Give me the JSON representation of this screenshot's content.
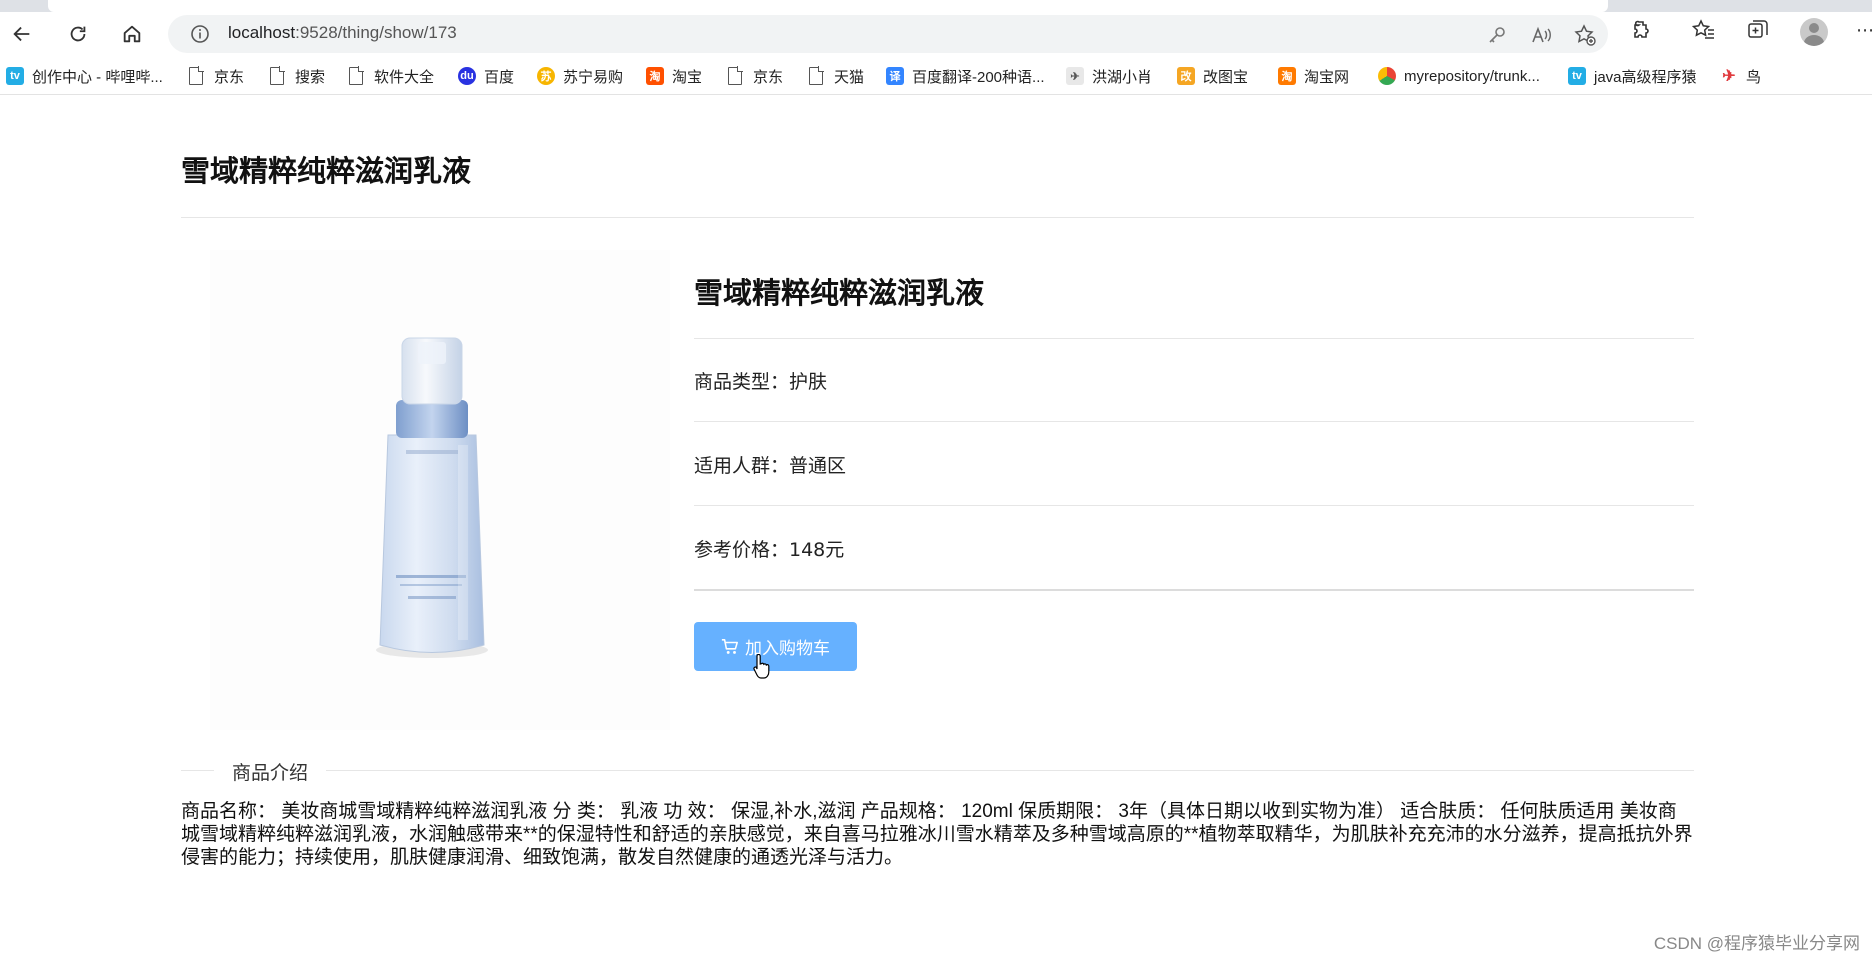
{
  "browser": {
    "url_host": "localhost",
    "url_path": ":9528/thing/show/173"
  },
  "bookmarks": [
    {
      "label": "创作中心 - 哔哩哔...",
      "icon": "bilibili-icon",
      "color": "#23ade5"
    },
    {
      "label": "京东",
      "icon": "page-icon"
    },
    {
      "label": "搜索",
      "icon": "page-icon"
    },
    {
      "label": "软件大全",
      "icon": "page-icon"
    },
    {
      "label": "百度",
      "icon": "baidu-paw-icon",
      "color": "#2932e1"
    },
    {
      "label": "苏宁易购",
      "icon": "suning-icon",
      "color": "#f7b500"
    },
    {
      "label": "淘宝",
      "icon": "taobao-icon",
      "color": "#ff5000"
    },
    {
      "label": "京东",
      "icon": "page-icon"
    },
    {
      "label": "天猫",
      "icon": "page-icon"
    },
    {
      "label": "百度翻译-200种语...",
      "icon": "baidu-translate-icon",
      "color": "#3385ff"
    },
    {
      "label": "洪湖小肖",
      "icon": "bird-icon",
      "color": "#6a6a6a"
    },
    {
      "label": "改图宝",
      "icon": "gaitubao-icon",
      "color": "#f5a623"
    },
    {
      "label": "淘宝网",
      "icon": "taobao-icon",
      "color": "#ff7a00"
    },
    {
      "label": "myrepository/trunk...",
      "icon": "chrome-icon",
      "color": "#4285f4"
    },
    {
      "label": "java高级程序猿",
      "icon": "bilibili-icon",
      "color": "#23ade5"
    },
    {
      "label": "鸟",
      "icon": "bird-red-icon",
      "color": "#e03a3e"
    }
  ],
  "page": {
    "title": "雪域精粹纯粹滋润乳液",
    "detail_title": "雪域精粹纯粹滋润乳液",
    "rows": [
      {
        "text": "商品类型：护肤"
      },
      {
        "text": "适用人群：普通区"
      },
      {
        "text": "参考价格：148元"
      }
    ],
    "cart_button": "加入购物车",
    "intro_label": "商品介绍",
    "intro_text": "商品名称： 美妆商城雪域精粹纯粹滋润乳液 分 类： 乳液 功 效： 保湿,补水,滋润 产品规格： 120ml 保质期限： 3年（具体日期以收到实物为准） 适合肤质： 任何肤质适用 美妆商城雪域精粹纯粹滋润乳液，水润触感带来**的保湿特性和舒适的亲肤感觉，来自喜马拉雅冰川雪水精萃及多种雪域高原的**植物萃取精华，为肌肤补充充沛的水分滋养，提高抵抗外界侵害的能力；持续使用，肌肤健康润滑、细致饱满，散发自然健康的通透光泽与活力。",
    "accent_color": "#66b1ff"
  },
  "watermark": "CSDN @程序猿毕业分享网"
}
